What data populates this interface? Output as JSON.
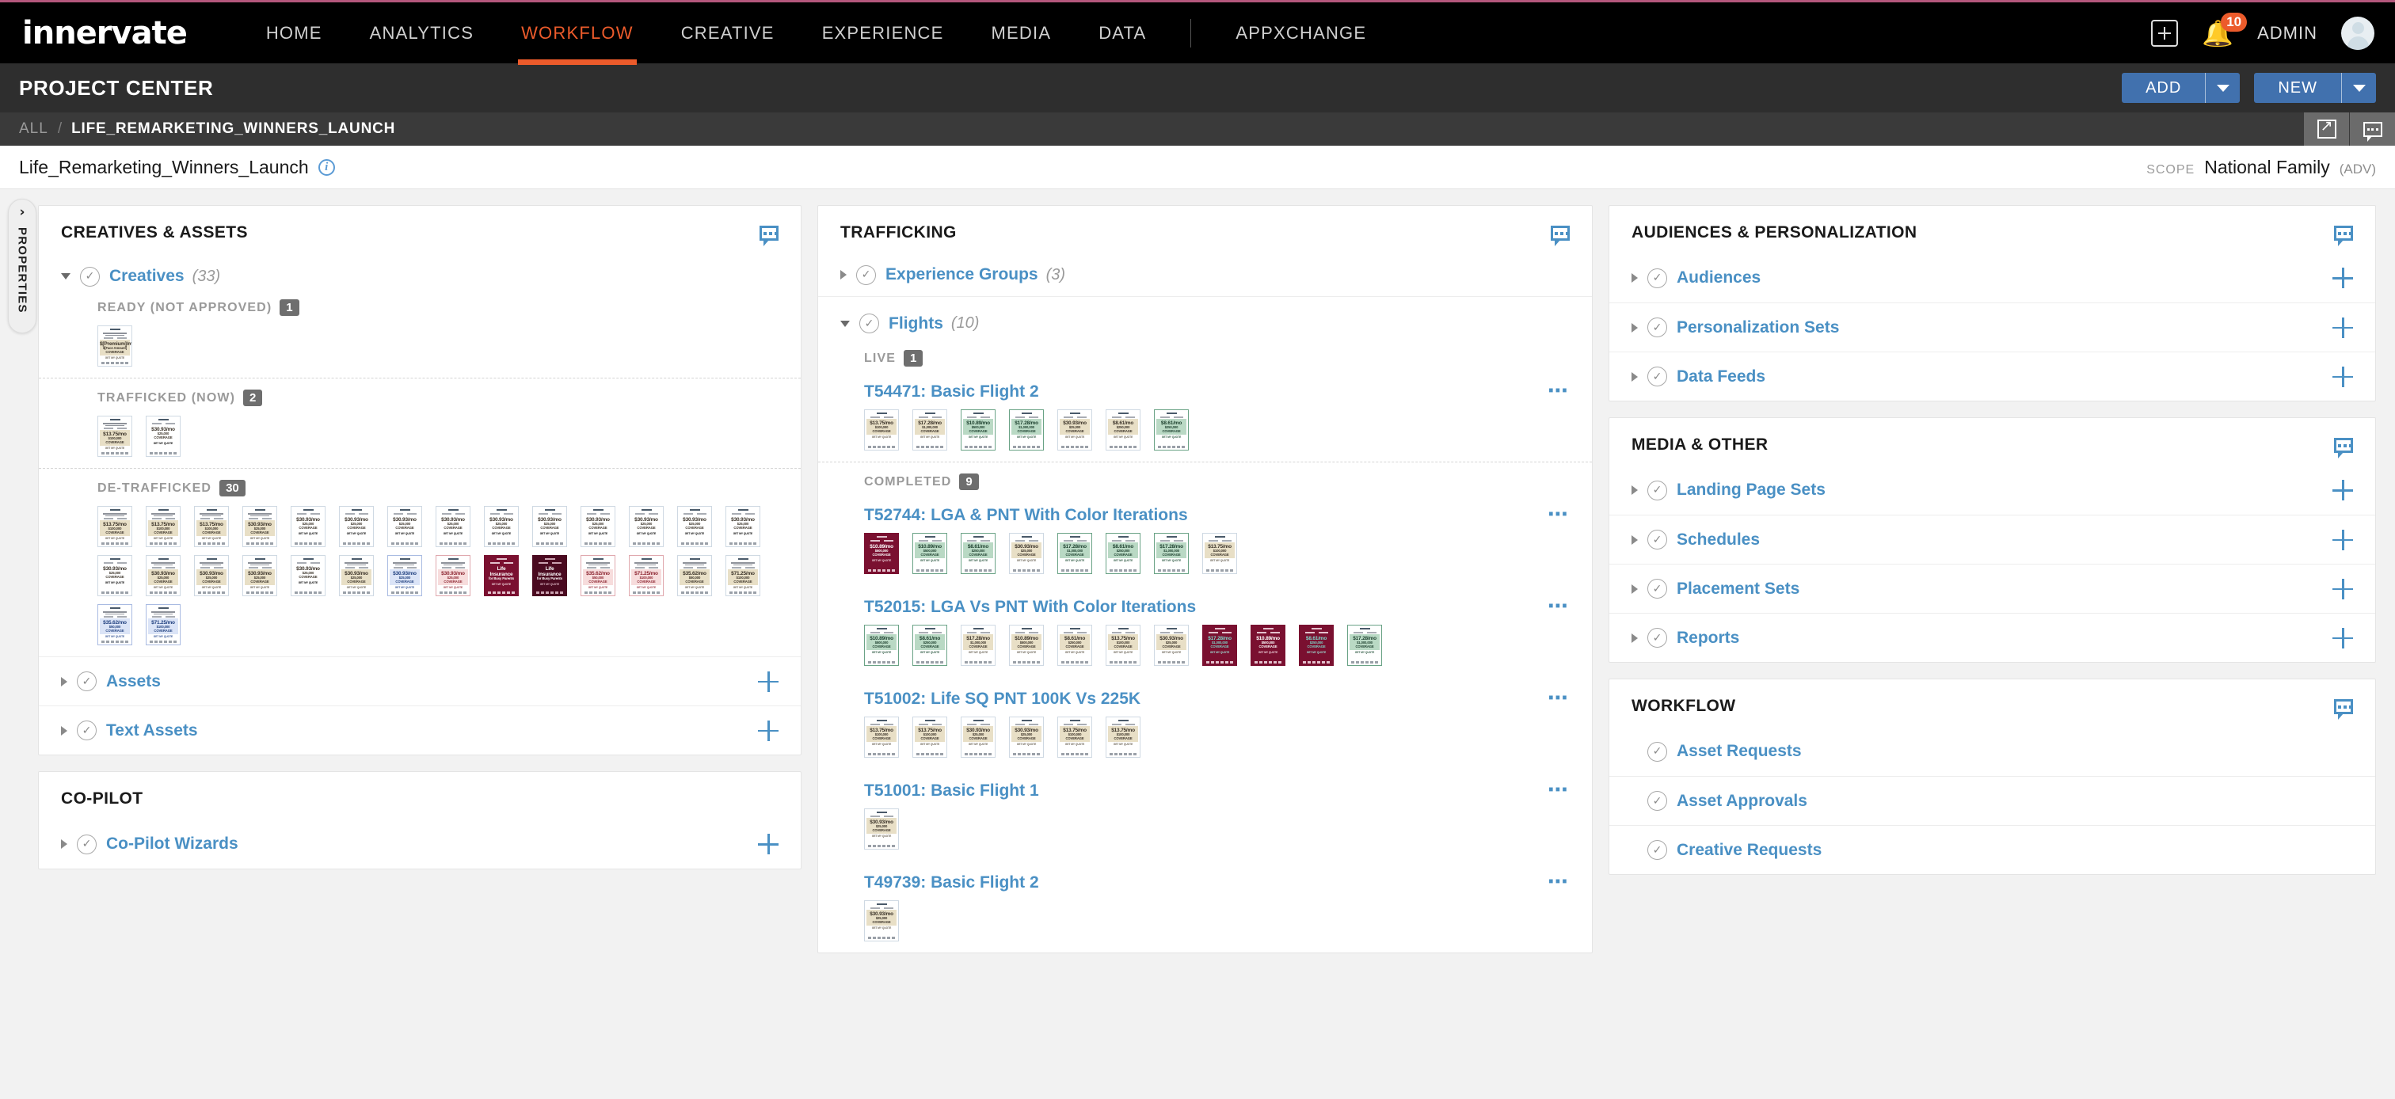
{
  "brand": {
    "logo": "innervate",
    "accent": "#ec5b2b",
    "link_blue": "#4a90c4",
    "button_blue": "#4171ae"
  },
  "topnav": {
    "items": [
      {
        "label": "HOME",
        "active": false
      },
      {
        "label": "ANALYTICS",
        "active": false
      },
      {
        "label": "WORKFLOW",
        "active": true
      },
      {
        "label": "CREATIVE",
        "active": false
      },
      {
        "label": "EXPERIENCE",
        "active": false
      },
      {
        "label": "MEDIA",
        "active": false
      },
      {
        "label": "DATA",
        "active": false
      },
      {
        "label": "APPXCHANGE",
        "active": false
      }
    ],
    "add_icon": "plus-box-icon",
    "notifications_icon": "bell-icon",
    "notifications_count": "10",
    "user_label": "ADMIN",
    "avatar_icon": "user-avatar-icon"
  },
  "pagebar": {
    "title": "PROJECT CENTER",
    "add_button": "ADD",
    "new_button": "NEW"
  },
  "breadcrumb": {
    "root": "ALL",
    "separator": "/",
    "current": "LIFE_REMARKETING_WINNERS_LAUNCH",
    "expand_icon": "expand-arrows-icon",
    "comment_icon": "comment-bubble-icon"
  },
  "project": {
    "name": "Life_Remarketing_Winners_Launch",
    "info_icon": "info-circle-icon",
    "scope_label": "SCOPE",
    "scope_value": "National Family",
    "scope_suffix": "(ADV)"
  },
  "properties_tab": {
    "label": "PROPERTIES",
    "chevron_icon": "chevron-right-icon"
  },
  "creatives_card": {
    "title": "CREATIVES & ASSETS",
    "comment_icon": "comment-bubble-icon",
    "creatives": {
      "label": "Creatives",
      "count": "(33)",
      "status_icon": "check-circle-icon",
      "caret_icon": "caret-down-icon",
      "sections": [
        {
          "label": "READY (NOT APPROVED)",
          "count": "1",
          "thumbs": [
            {
              "theme": "cream",
              "price": "$[Premium]/mo",
              "cov": "$[Face Amount] COVERAGE",
              "head": "[Image Headline]"
            }
          ]
        },
        {
          "label": "TRAFFICKED (NOW)",
          "count": "2",
          "thumbs": [
            {
              "theme": "cream",
              "price": "$13.75/mo",
              "cov": "$100,000 COVERAGE",
              "head": "LIFE INSURANCE WITHOUT THE HEADACHE"
            },
            {
              "theme": "white",
              "price": "$30.93/mo",
              "cov": "$25,000 COVERAGE",
              "head": ""
            }
          ]
        },
        {
          "label": "DE-TRAFFICKED",
          "count": "30",
          "thumbs": [
            {
              "theme": "cream",
              "price": "$13.75/mo",
              "cov": "$100,000 COVERAGE",
              "head": "ARE YOU A VETERAN OF LIFE INSURANCE?"
            },
            {
              "theme": "cream",
              "price": "$13.75/mo",
              "cov": "$100,000 COVERAGE",
              "head": "ARE YOU A VETERAN OF LIFE INSURANCE?"
            },
            {
              "theme": "cream",
              "price": "$13.75/mo",
              "cov": "$100,000 COVERAGE",
              "head": "HELP SECURE YOUR FAMILY'S FUTURE WITH LIFE INSURANCE"
            },
            {
              "theme": "cream",
              "price": "$30.93/mo",
              "cov": "$25,000 COVERAGE",
              "head": "LIFE INSURANCE FOR BUSY PARENTS"
            },
            {
              "theme": "white",
              "price": "$30.93/mo",
              "cov": "$25,000 COVERAGE",
              "head": ""
            },
            {
              "theme": "white",
              "price": "$30.93/mo",
              "cov": "$25,000 COVERAGE",
              "head": ""
            },
            {
              "theme": "white",
              "price": "$30.93/mo",
              "cov": "$25,000 COVERAGE",
              "head": ""
            },
            {
              "theme": "white",
              "price": "$30.93/mo",
              "cov": "$25,000 COVERAGE",
              "head": ""
            },
            {
              "theme": "white",
              "price": "$30.93/mo",
              "cov": "$25,000 COVERAGE",
              "head": ""
            },
            {
              "theme": "white",
              "price": "$30.93/mo",
              "cov": "$25,000 COVERAGE",
              "head": ""
            },
            {
              "theme": "white",
              "price": "$30.93/mo",
              "cov": "$25,000 COVERAGE",
              "head": ""
            },
            {
              "theme": "white",
              "price": "$30.93/mo",
              "cov": "$25,000 COVERAGE",
              "head": ""
            },
            {
              "theme": "white",
              "price": "$30.93/mo",
              "cov": "$25,000 COVERAGE",
              "head": ""
            },
            {
              "theme": "white",
              "price": "$30.93/mo",
              "cov": "$25,000 COVERAGE",
              "head": ""
            },
            {
              "theme": "white",
              "price": "$30.93/mo",
              "cov": "$25,000 COVERAGE",
              "head": ""
            },
            {
              "theme": "cream",
              "price": "$30.93/mo",
              "cov": "$25,000 COVERAGE",
              "head": "LIFE INSURANCE TO HELP PROTECT YOUR FAMILY"
            },
            {
              "theme": "cream",
              "price": "$30.93/mo",
              "cov": "$25,000 COVERAGE",
              "head": "LIFE INSURANCE TO HELP PROTECT YOUR FAMILY"
            },
            {
              "theme": "cream",
              "price": "$30.93/mo",
              "cov": "$25,000 COVERAGE",
              "head": "LIFE INSURANCE TO HELP PROTECT YOUR FAMILY"
            },
            {
              "theme": "white",
              "price": "$30.93/mo",
              "cov": "$25,000 COVERAGE",
              "head": ""
            },
            {
              "theme": "cream",
              "price": "$30.93/mo",
              "cov": "$25,000 COVERAGE",
              "head": "LIFE INSURANCE TO HELP PROTECT YOUR FAMILY"
            },
            {
              "theme": "blue",
              "price": "$30.93/mo",
              "cov": "$25,000 COVERAGE",
              "head": "LIFE INSURANCE TO HELP PROTECT YOUR FAMILY"
            },
            {
              "theme": "pink",
              "price": "$30.93/mo",
              "cov": "$25,000 COVERAGE",
              "head": "LIFE INSURANCE TO HELP PROTECT YOUR FAMILY"
            },
            {
              "theme": "maroon",
              "price": "Life Insurance",
              "cov": "for Busy Parents",
              "head": ""
            },
            {
              "theme": "darkmaroon",
              "price": "Life Insurance",
              "cov": "for Busy Parents",
              "head": ""
            },
            {
              "theme": "pink",
              "price": "$35.62/mo",
              "cov": "$50,000 COVERAGE",
              "head": "LIFE INSURANCE TO HELP PROTECT YOUR FAMILY"
            },
            {
              "theme": "pink",
              "price": "$71.25/mo",
              "cov": "$100,000 COVERAGE",
              "head": "LIFE INSURANCE TO HELP PROTECT YOUR FAMILY"
            },
            {
              "theme": "cream",
              "price": "$35.62/mo",
              "cov": "$50,000 COVERAGE",
              "head": "LIFE INSURANCE TO HELP PROTECT YOUR FAMILY"
            },
            {
              "theme": "cream",
              "price": "$71.25/mo",
              "cov": "$100,000 COVERAGE",
              "head": "LIFE INSURANCE TO HELP PROTECT YOUR FAMILY"
            },
            {
              "theme": "blue",
              "price": "$35.62/mo",
              "cov": "$50,000 COVERAGE",
              "head": "LIFE INSURANCE TO HELP PROTECT YOUR FAMILY"
            },
            {
              "theme": "blue",
              "price": "$71.25/mo",
              "cov": "$100,000 COVERAGE",
              "head": "LIFE INSURANCE TO HELP PROTECT YOUR FAMILY"
            }
          ]
        }
      ]
    },
    "rows": [
      {
        "label": "Assets",
        "caret_icon": "caret-right-icon",
        "status_icon": "check-circle-icon",
        "add_icon": "plus-icon"
      },
      {
        "label": "Text Assets",
        "caret_icon": "caret-right-icon",
        "status_icon": "check-circle-icon",
        "add_icon": "plus-icon"
      }
    ]
  },
  "copilot_card": {
    "title": "CO-PILOT",
    "rows": [
      {
        "label": "Co-Pilot Wizards",
        "caret_icon": "caret-right-icon",
        "status_icon": "check-circle-icon",
        "add_icon": "plus-icon"
      }
    ]
  },
  "trafficking_card": {
    "title": "TRAFFICKING",
    "comment_icon": "comment-bubble-icon",
    "experience_groups": {
      "label": "Experience Groups",
      "count": "(3)",
      "caret_icon": "caret-right-icon",
      "status_icon": "check-circle-icon"
    },
    "flights": {
      "label": "Flights",
      "count": "(10)",
      "caret_icon": "caret-down-icon",
      "status_icon": "check-circle-icon",
      "groups": [
        {
          "status": "LIVE",
          "status_count": "1",
          "items": [
            {
              "title": "T54471: Basic Flight 2",
              "menu_icon": "ellipsis-icon",
              "thumbs": [
                {
                  "theme": "cream",
                  "price": "$13.75/mo",
                  "cov": "$100,000 COVERAGE"
                },
                {
                  "theme": "cream",
                  "price": "$17.28/mo",
                  "cov": "$1,000,000 COVERAGE"
                },
                {
                  "theme": "green",
                  "price": "$10.89/mo",
                  "cov": "$500,000 COVERAGE"
                },
                {
                  "theme": "green",
                  "price": "$17.28/mo",
                  "cov": "$1,000,000 COVERAGE"
                },
                {
                  "theme": "cream",
                  "price": "$30.93/mo",
                  "cov": "$25,000 COVERAGE"
                },
                {
                  "theme": "cream",
                  "price": "$8.61/mo",
                  "cov": "$250,000 COVERAGE"
                },
                {
                  "theme": "green",
                  "price": "$8.61/mo",
                  "cov": "$250,000 COVERAGE"
                }
              ]
            }
          ]
        },
        {
          "status": "COMPLETED",
          "status_count": "9",
          "items": [
            {
              "title": "T52744: LGA & PNT With Color Iterations",
              "menu_icon": "ellipsis-icon",
              "thumbs": [
                {
                  "theme": "maroon",
                  "price": "$10.89/mo",
                  "cov": "$500,000 COVERAGE"
                },
                {
                  "theme": "green",
                  "price": "$10.89/mo",
                  "cov": "$500,000 COVERAGE"
                },
                {
                  "theme": "green",
                  "price": "$8.61/mo",
                  "cov": "$250,000 COVERAGE"
                },
                {
                  "theme": "cream",
                  "price": "$30.93/mo",
                  "cov": "$25,000 COVERAGE"
                },
                {
                  "theme": "green",
                  "price": "$17.28/mo",
                  "cov": "$1,000,000 COVERAGE"
                },
                {
                  "theme": "green",
                  "price": "$8.61/mo",
                  "cov": "$250,000 COVERAGE"
                },
                {
                  "theme": "green",
                  "price": "$17.28/mo",
                  "cov": "$1,000,000 COVERAGE"
                },
                {
                  "theme": "cream",
                  "price": "$13.75/mo",
                  "cov": "$100,000 COVERAGE"
                }
              ]
            },
            {
              "title": "T52015: LGA Vs PNT With Color Iterations",
              "menu_icon": "ellipsis-icon",
              "thumbs": [
                {
                  "theme": "green",
                  "price": "$10.89/mo",
                  "cov": "$500,000 COVERAGE"
                },
                {
                  "theme": "green",
                  "price": "$8.61/mo",
                  "cov": "$250,000 COVERAGE"
                },
                {
                  "theme": "cream",
                  "price": "$17.28/mo",
                  "cov": "$1,000,000 COVERAGE"
                },
                {
                  "theme": "cream",
                  "price": "$10.89/mo",
                  "cov": "$500,000 COVERAGE"
                },
                {
                  "theme": "cream",
                  "price": "$8.61/mo",
                  "cov": "$250,000 COVERAGE"
                },
                {
                  "theme": "cream",
                  "price": "$13.75/mo",
                  "cov": "$100,000 COVERAGE"
                },
                {
                  "theme": "cream",
                  "price": "$30.93/mo",
                  "cov": "$25,000 COVERAGE"
                },
                {
                  "theme": "teal",
                  "price": "$17.28/mo",
                  "cov": "$1,000,000 COVERAGE"
                },
                {
                  "theme": "maroon",
                  "price": "$10.89/mo",
                  "cov": "$500,000 COVERAGE"
                },
                {
                  "theme": "teal",
                  "price": "$8.61/mo",
                  "cov": "$250,000 COVERAGE"
                },
                {
                  "theme": "green",
                  "price": "$17.28/mo",
                  "cov": "$1,000,000 COVERAGE"
                }
              ]
            },
            {
              "title": "T51002: Life SQ PNT 100K Vs 225K",
              "menu_icon": "ellipsis-icon",
              "thumbs": [
                {
                  "theme": "cream",
                  "price": "$13.75/mo",
                  "cov": "$100,000 COVERAGE"
                },
                {
                  "theme": "cream",
                  "price": "$13.75/mo",
                  "cov": "$100,000 COVERAGE"
                },
                {
                  "theme": "cream",
                  "price": "$30.93/mo",
                  "cov": "$25,000 COVERAGE"
                },
                {
                  "theme": "cream",
                  "price": "$30.93/mo",
                  "cov": "$25,000 COVERAGE"
                },
                {
                  "theme": "cream",
                  "price": "$13.75/mo",
                  "cov": "$100,000 COVERAGE"
                },
                {
                  "theme": "cream",
                  "price": "$13.75/mo",
                  "cov": "$100,000 COVERAGE"
                }
              ]
            },
            {
              "title": "T51001: Basic Flight 1",
              "menu_icon": "ellipsis-icon",
              "thumbs": [
                {
                  "theme": "cream",
                  "price": "$30.93/mo",
                  "cov": "$25,000 COVERAGE"
                }
              ]
            },
            {
              "title": "T49739: Basic Flight 2",
              "menu_icon": "ellipsis-icon",
              "thumbs": [
                {
                  "theme": "cream",
                  "price": "$30.93/mo",
                  "cov": "$25,000 COVERAGE"
                }
              ]
            }
          ]
        }
      ]
    }
  },
  "audiences_card": {
    "title": "AUDIENCES & PERSONALIZATION",
    "comment_icon": "comment-bubble-icon",
    "rows": [
      {
        "label": "Audiences",
        "caret_icon": "caret-right-icon",
        "status_icon": "check-circle-icon",
        "add_icon": "plus-icon"
      },
      {
        "label": "Personalization Sets",
        "caret_icon": "caret-right-icon",
        "status_icon": "check-circle-icon",
        "add_icon": "plus-icon"
      },
      {
        "label": "Data Feeds",
        "caret_icon": "caret-right-icon",
        "status_icon": "check-circle-icon",
        "add_icon": "plus-icon"
      }
    ]
  },
  "media_card": {
    "title": "MEDIA & OTHER",
    "comment_icon": "comment-bubble-icon",
    "rows": [
      {
        "label": "Landing Page Sets",
        "caret_icon": "caret-right-icon",
        "status_icon": "check-circle-icon",
        "add_icon": "plus-icon"
      },
      {
        "label": "Schedules",
        "caret_icon": "caret-right-icon",
        "status_icon": "check-circle-icon",
        "add_icon": "plus-icon"
      },
      {
        "label": "Placement Sets",
        "caret_icon": "caret-right-icon",
        "status_icon": "check-circle-icon",
        "add_icon": "plus-icon"
      },
      {
        "label": "Reports",
        "caret_icon": "caret-right-icon",
        "status_icon": "check-circle-icon",
        "add_icon": "plus-icon"
      }
    ]
  },
  "workflow_card": {
    "title": "WORKFLOW",
    "comment_icon": "comment-bubble-icon",
    "rows": [
      {
        "label": "Asset Requests",
        "status_icon": "check-circle-icon"
      },
      {
        "label": "Asset Approvals",
        "status_icon": "check-circle-icon"
      },
      {
        "label": "Creative Requests",
        "status_icon": "check-circle-icon"
      }
    ]
  }
}
